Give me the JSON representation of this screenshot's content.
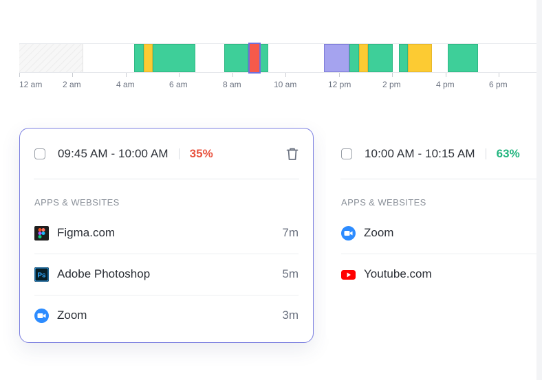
{
  "timeline": {
    "hours": [
      "12 am",
      "2 am",
      "4 am",
      "6 am",
      "8 am",
      "10 am",
      "12 pm",
      "2 pm",
      "4 pm",
      "6 pm"
    ]
  },
  "cards": [
    {
      "time_range": "09:45 AM - 10:00 AM",
      "percent": "35%",
      "section_title": "APPS & WEBSITES",
      "apps": [
        {
          "name": "Figma.com",
          "duration": "7m",
          "icon": "figma-icon"
        },
        {
          "name": "Adobe Photoshop",
          "duration": "5m",
          "icon": "photoshop-icon"
        },
        {
          "name": "Zoom",
          "duration": "3m",
          "icon": "zoom-icon"
        }
      ]
    },
    {
      "time_range": "10:00 AM - 10:15 AM",
      "percent": "63%",
      "section_title": "APPS & WEBSITES",
      "apps": [
        {
          "name": "Zoom",
          "icon": "zoom-icon"
        },
        {
          "name": "Youtube.com",
          "icon": "youtube-icon"
        }
      ]
    }
  ],
  "colors": {
    "productive": "#3ecf99",
    "neutral": "#fccb33",
    "unproductive": "#f65a4b",
    "manual": "#a5a3ef",
    "selected_border": "#7b7fe0",
    "percent_low": "#e8533f",
    "percent_high": "#23b57f"
  }
}
